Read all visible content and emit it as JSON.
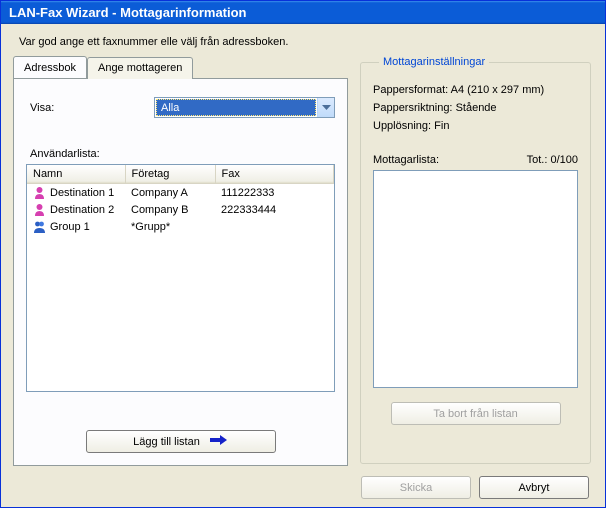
{
  "titlebar": {
    "title": "LAN-Fax Wizard - Mottagarinformation"
  },
  "instruction": "Var god ange ett faxnummer elle välj från adressboken.",
  "tabs": {
    "adressbok": "Adressbok",
    "ange": "Ange mottageren"
  },
  "adressbok": {
    "visa_label": "Visa:",
    "visa_value": "Alla",
    "userlist_label": "Användarlista:",
    "columns": {
      "name": "Namn",
      "company": "Företag",
      "fax": "Fax"
    },
    "rows": [
      {
        "type": "person",
        "name": "Destination 1",
        "company": "Company A",
        "fax": "111222333"
      },
      {
        "type": "person",
        "name": "Destination 2",
        "company": "Company B",
        "fax": "222333444"
      },
      {
        "type": "group",
        "name": "Group 1",
        "company": "*Grupp*",
        "fax": ""
      }
    ],
    "add_button": "Lägg till listan"
  },
  "settings": {
    "legend": "Mottagarinställningar",
    "paper_format_label": "Pappersformat:",
    "paper_format_value": "A4 (210 x 297 mm)",
    "orientation_label": "Pappersriktning:",
    "orientation_value": "Stående",
    "resolution_label": "Upplösning:",
    "resolution_value": "Fin",
    "list_label": "Mottagarlista:",
    "total_label": "Tot.: 0/100",
    "remove_button": "Ta bort från listan"
  },
  "buttons": {
    "send": "Skicka",
    "cancel": "Avbryt"
  }
}
